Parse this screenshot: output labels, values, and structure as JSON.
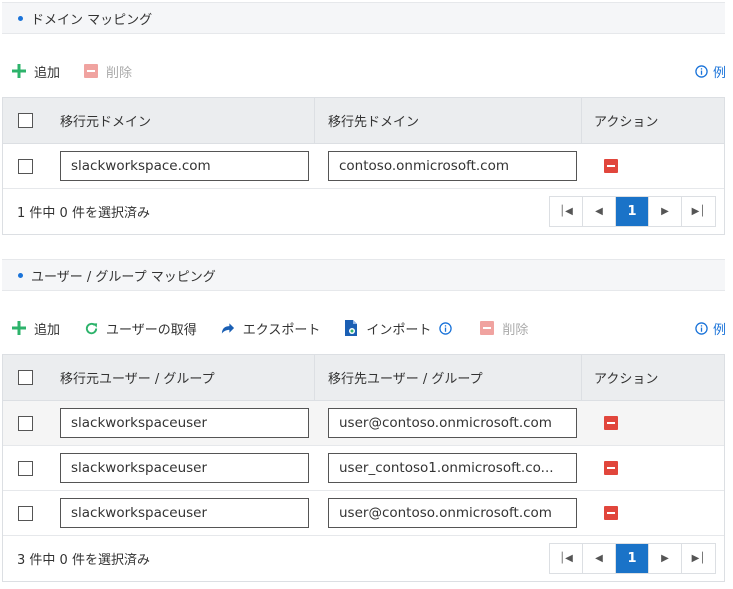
{
  "domain_section": {
    "title": "ドメイン マッピング",
    "toolbar": {
      "add_label": "追加",
      "delete_label": "削除",
      "example_label": "例"
    },
    "columns": {
      "source": "移行元ドメイン",
      "target": "移行先ドメイン",
      "action": "アクション"
    },
    "rows": [
      {
        "source": "slackworkspace.com",
        "target": "contoso.onmicrosoft.com"
      }
    ],
    "footer": {
      "count_text": "1 件中 0 件を選択済み",
      "current_page": "1"
    }
  },
  "user_section": {
    "title": "ユーザー / グループ マッピング",
    "toolbar": {
      "add_label": "追加",
      "fetch_label": "ユーザーの取得",
      "export_label": "エクスポート",
      "import_label": "インポート",
      "delete_label": "削除",
      "example_label": "例"
    },
    "columns": {
      "source": "移行元ユーザー / グループ",
      "target": "移行先ユーザー / グループ",
      "action": "アクション"
    },
    "rows": [
      {
        "source": "slackworkspaceuser",
        "target": "user@contoso.onmicrosoft.com"
      },
      {
        "source": "slackworkspaceuser",
        "target": "user_contoso1.onmicrosoft.co..."
      },
      {
        "source": "slackworkspaceuser",
        "target": "user@contoso.onmicrosoft.com"
      }
    ],
    "footer": {
      "count_text": "3 件中 0 件を選択済み",
      "current_page": "1"
    }
  },
  "colors": {
    "accent": "#1a73c8",
    "add_green": "#2db36b",
    "remove_red": "#e1463c",
    "header_bg": "#ebedef"
  },
  "icons": [
    "plus-icon",
    "minus-square-icon",
    "info-icon",
    "refresh-icon",
    "share-arrow-icon",
    "import-file-icon",
    "first-page-icon",
    "prev-page-icon",
    "next-page-icon",
    "last-page-icon"
  ]
}
